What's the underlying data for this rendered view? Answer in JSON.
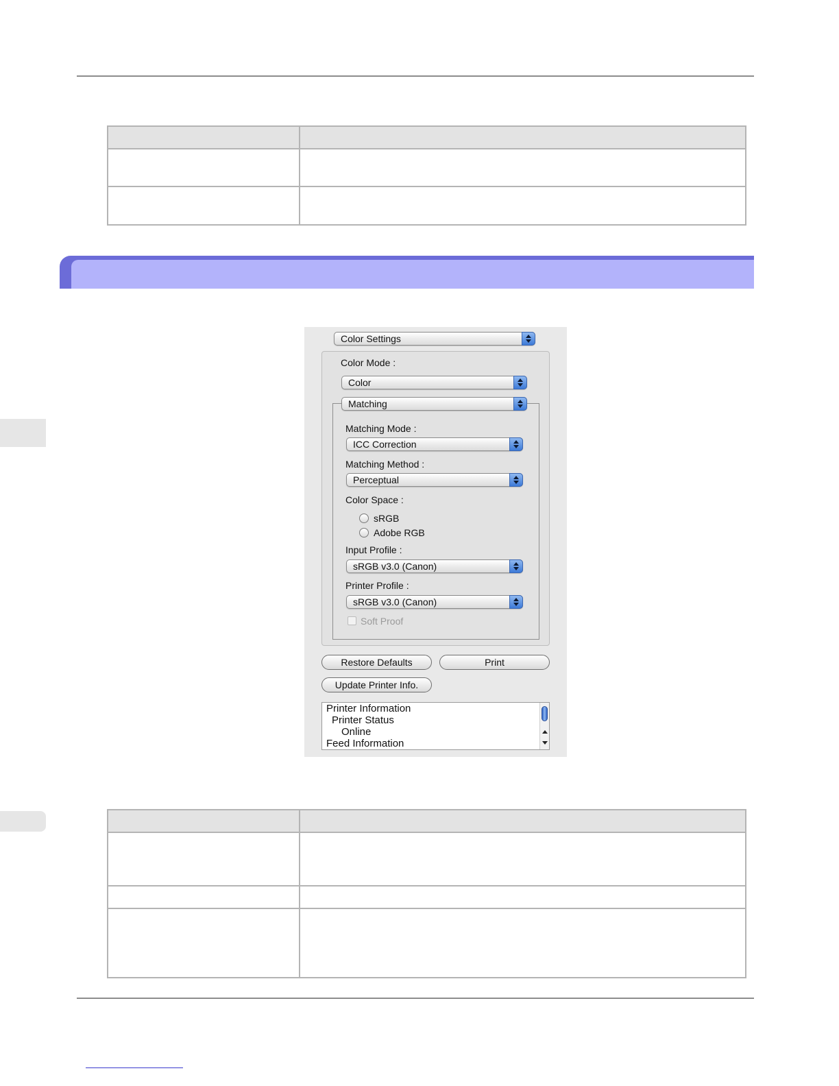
{
  "dialog": {
    "panel_popup": "Color Settings",
    "color_mode_label": "Color Mode :",
    "color_mode_value": "Color",
    "matching_popup": "Matching",
    "matching_mode_label": "Matching Mode :",
    "matching_mode_value": "ICC Correction",
    "matching_method_label": "Matching Method :",
    "matching_method_value": "Perceptual",
    "color_space_label": "Color Space :",
    "color_space_options": [
      "sRGB",
      "Adobe RGB"
    ],
    "input_profile_label": "Input Profile :",
    "input_profile_value": "sRGB v3.0 (Canon)",
    "printer_profile_label": "Printer Profile :",
    "printer_profile_value": "sRGB v3.0 (Canon)",
    "soft_proof_label": "Soft Proof",
    "restore_defaults_label": "Restore Defaults",
    "print_label": "Print",
    "update_printer_info_label": "Update Printer Info.",
    "printer_info_list": [
      "Printer Information",
      "Printer Status",
      "Online",
      "Feed Information"
    ]
  },
  "colors": {
    "section_bar_outer": "#6c6cd8",
    "section_bar_inner": "#b3b3fb",
    "popup_arrow_accent": "#3d7ad8"
  }
}
